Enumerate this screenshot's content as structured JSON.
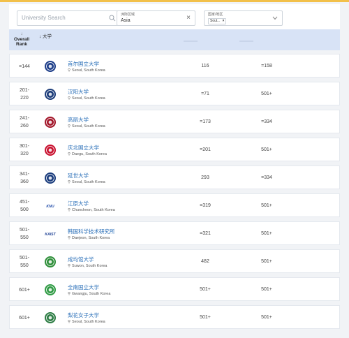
{
  "filters": {
    "search_placeholder": "University Search",
    "region_label": "洲际区域",
    "region_value": "Asia",
    "country_label": "国家/地区",
    "country_chip": "Sout..."
  },
  "header": {
    "rank_arrow": "↓",
    "rank_label": "Overall Rank",
    "uni_label": "↓ 大学"
  },
  "rows": [
    {
      "rank": "=144",
      "name": "首尔国立大学",
      "location": "Seoul, South Korea",
      "c1": "116",
      "c2": "=158"
    },
    {
      "rank": "201-\n220",
      "name": "汉阳大学",
      "location": "Seoul, South Korea",
      "c1": "=71",
      "c2": "501+"
    },
    {
      "rank": "241-\n260",
      "name": "高丽大学",
      "location": "Seoul, South Korea",
      "c1": "=173",
      "c2": "=334"
    },
    {
      "rank": "301-\n320",
      "name": "庆北国立大学",
      "location": "Daegu, South Korea",
      "c1": "=201",
      "c2": "501+"
    },
    {
      "rank": "341-\n360",
      "name": "延世大学",
      "location": "Seoul, South Korea",
      "c1": "293",
      "c2": "=334"
    },
    {
      "rank": "451-\n500",
      "name": "江原大学",
      "location": "Chuncheon, South Korea",
      "c1": "=319",
      "c2": "501+"
    },
    {
      "rank": "501-\n550",
      "name": "韩国科学技术研究所",
      "location": "Daejeon, South Korea",
      "c1": "=321",
      "c2": "501+"
    },
    {
      "rank": "501-\n550",
      "name": "成均馆大学",
      "location": "Suwon, South Korea",
      "c1": "482",
      "c2": "501+"
    },
    {
      "rank": "601+",
      "name": "全南国立大学",
      "location": "Gwangju, South Korea",
      "c1": "501+",
      "c2": "501+"
    },
    {
      "rank": "601+",
      "name": "梨花女子大学",
      "location": "Seoul, South Korea",
      "c1": "501+",
      "c2": "501+"
    }
  ],
  "logos": [
    {
      "icon": "snu-emblem-icon",
      "color": "#1f3f8a",
      "text": ""
    },
    {
      "icon": "hanyang-emblem-icon",
      "color": "#1d3d7a",
      "text": ""
    },
    {
      "icon": "korea-univ-crest-icon",
      "color": "#a3172b",
      "text": ""
    },
    {
      "icon": "kyungpook-emblem-icon",
      "color": "#c8102e",
      "text": ""
    },
    {
      "icon": "yonsei-shield-icon",
      "color": "#1b3d7d",
      "text": ""
    },
    {
      "icon": "knu-wordmark-icon",
      "color": "#1f4aa8",
      "text": "KNU"
    },
    {
      "icon": "kaist-wordmark-icon",
      "color": "#1c3f94",
      "text": "KAIST"
    },
    {
      "icon": "skku-emblem-icon",
      "color": "#2f8f3a",
      "text": ""
    },
    {
      "icon": "chonnam-emblem-icon",
      "color": "#2f9a44",
      "text": ""
    },
    {
      "icon": "ewha-emblem-icon",
      "color": "#2e7d45",
      "text": ""
    }
  ]
}
